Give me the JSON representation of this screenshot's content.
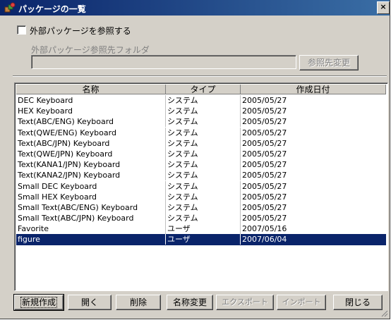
{
  "window": {
    "title": "パッケージの一覧",
    "close_label": "×"
  },
  "external": {
    "checkbox_label": "外部パッケージを参照する",
    "checked": false,
    "folder_label": "外部パッケージ参照先フォルダ",
    "folder_value": "",
    "change_button": "参照先変更"
  },
  "table": {
    "headers": [
      "名称",
      "タイプ",
      "作成日付"
    ],
    "rows": [
      [
        "DEC Keyboard",
        "システム",
        "2005/05/27"
      ],
      [
        "HEX Keyboard",
        "システム",
        "2005/05/27"
      ],
      [
        "Text(ABC/ENG) Keyboard",
        "システム",
        "2005/05/27"
      ],
      [
        "Text(QWE/ENG) Keyboard",
        "システム",
        "2005/05/27"
      ],
      [
        "Text(ABC/JPN) Keyboard",
        "システム",
        "2005/05/27"
      ],
      [
        "Text(QWE/JPN) Keyboard",
        "システム",
        "2005/05/27"
      ],
      [
        "Text(KANA1/JPN) Keyboard",
        "システム",
        "2005/05/27"
      ],
      [
        "Text(KANA2/JPN) Keyboard",
        "システム",
        "2005/05/27"
      ],
      [
        "Small DEC Keyboard",
        "システム",
        "2005/05/27"
      ],
      [
        "Small HEX Keyboard",
        "システム",
        "2005/05/27"
      ],
      [
        "Small Text(ABC/ENG) Keyboard",
        "システム",
        "2005/05/27"
      ],
      [
        "Small Text(ABC/JPN) Keyboard",
        "システム",
        "2005/05/27"
      ],
      [
        "Favorite",
        "ユーザ",
        "2007/05/16"
      ],
      [
        "figure",
        "ユーザ",
        "2007/06/04"
      ]
    ],
    "selected_index": 13
  },
  "buttons": {
    "new": "新規作成",
    "open": "開く",
    "delete": "削除",
    "rename": "名称変更",
    "export": "エクスポート",
    "import": "インポート",
    "close": "閉じる"
  },
  "colors": {
    "titlebar": "#0a246a",
    "selection": "#0a246a",
    "face": "#d4d0c8"
  }
}
